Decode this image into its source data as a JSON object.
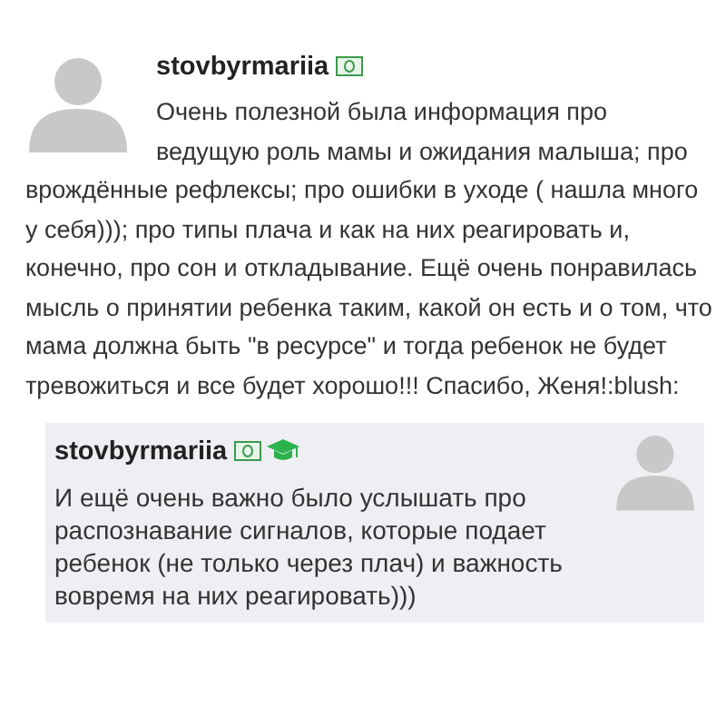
{
  "comment": {
    "author": "stovbyrmariia",
    "badges": [
      {
        "kind": "money"
      }
    ],
    "text_parts": [
      "Очень полезной была информация про ведущую роль мамы и ожидания малыша; про",
      "врождённые рефлексы; про ошибки в уходе ( нашла много у себя))); про типы плача и как на них реагировать и, конечно, про сон и откладывание. Ещё очень понравилась мысль о принятии ребенка таким, какой он есть и о том, что мама должна быть \"в ресурсе\" и тогда ребенок не будет тревожиться и все будет хорошо!!! Спасибо, Женя!:blush:"
    ]
  },
  "reply": {
    "author": "stovbyrmariia",
    "badges": [
      {
        "kind": "money"
      },
      {
        "kind": "graduate"
      }
    ],
    "text": "И ещё очень важно было услышать про распознавание сигналов, которые подает ребенок (не только через плач) и важность вовремя на них реагировать)))"
  }
}
